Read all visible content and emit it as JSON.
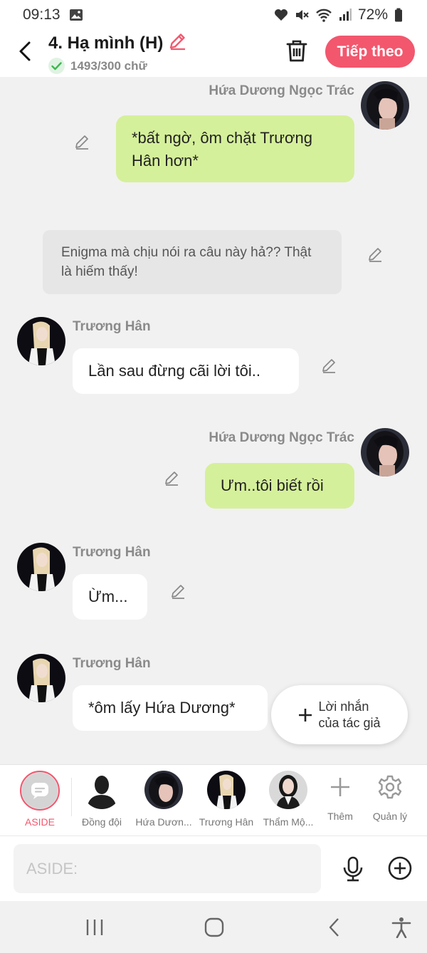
{
  "status_bar": {
    "time": "09:13",
    "battery": "72%"
  },
  "header": {
    "title": "4. Hạ mình (H)",
    "word_count": "1493/300 chữ",
    "next_label": "Tiếp theo"
  },
  "messages": [
    {
      "sender": "Hứa Dương Ngọc Trác",
      "text": "*bất ngờ, ôm chặt Trương Hân hơn*"
    },
    {
      "text": "Enigma mà chịu nói ra câu này hả?? Thật là hiếm thấy!"
    },
    {
      "sender": "Trương Hân",
      "text": "Lần sau đừng cãi lời tôi.."
    },
    {
      "sender": "Hứa Dương Ngọc Trác",
      "text": "Ưm..tôi biết rồi"
    },
    {
      "sender": "Trương Hân",
      "text": "Ừm..."
    },
    {
      "sender": "Trương Hân",
      "text": "*ôm lấy Hứa Dương*"
    }
  ],
  "author_note": {
    "line1": "Lời nhắn",
    "line2": "của tác giả"
  },
  "characters": [
    {
      "label": "ASIDE"
    },
    {
      "label": "Đồng đội"
    },
    {
      "label": "Hứa Dươn..."
    },
    {
      "label": "Trương Hân"
    },
    {
      "label": "Thẩm Mộ..."
    },
    {
      "label": "Thêm"
    },
    {
      "label": "Quản lý"
    }
  ],
  "input": {
    "placeholder": "ASIDE:"
  },
  "colors": {
    "accent": "#f2576e",
    "user_bubble": "#d5f09a",
    "narration_bubble": "#e6e6e6"
  }
}
